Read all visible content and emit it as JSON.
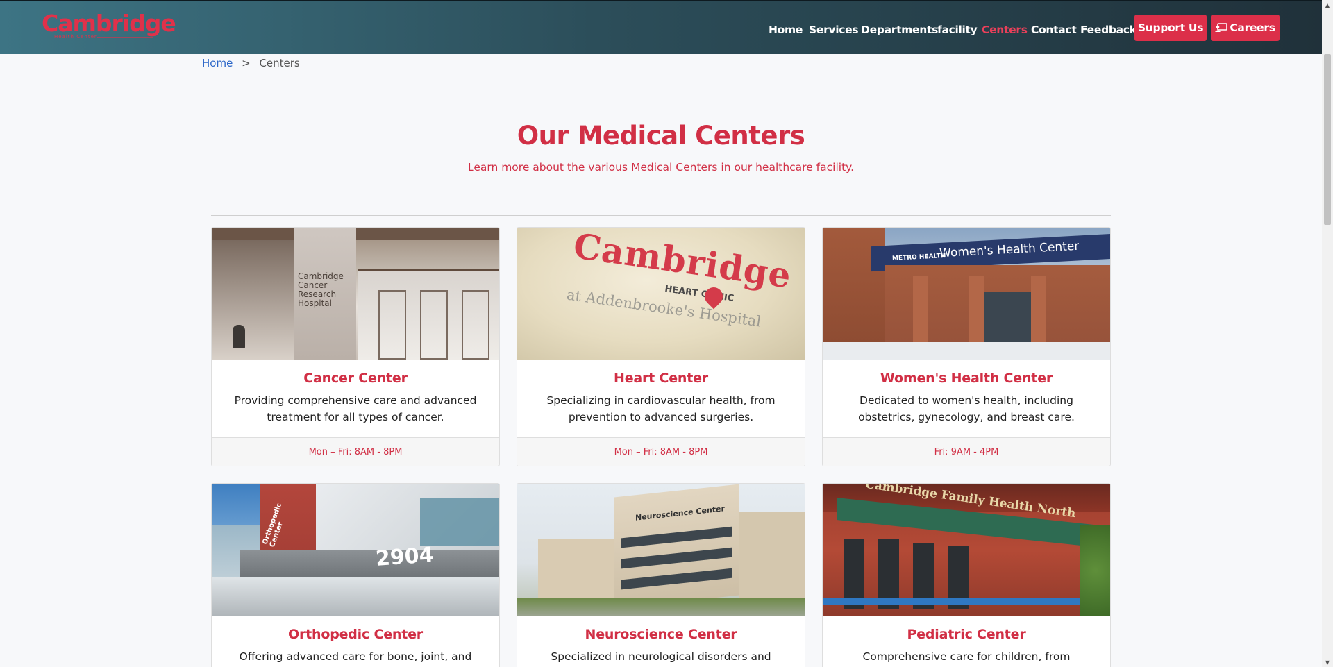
{
  "brand": {
    "name": "Cambridge",
    "tagline": "Health Center"
  },
  "nav": {
    "items": [
      "Home",
      "Services",
      "Departments",
      "facility",
      "Centers",
      "Contact",
      "Feedback"
    ],
    "active": "Centers",
    "support_label": "Support Us",
    "careers_label": "Careers"
  },
  "breadcrumb": {
    "home": "Home",
    "separator": ">",
    "current": "Centers"
  },
  "page": {
    "title": "Our Medical Centers",
    "subtitle": "Learn more about the various Medical Centers in our healthcare facility."
  },
  "centers": [
    {
      "title": "Cancer Center",
      "description": "Providing comprehensive care and advanced treatment for all types of cancer.",
      "hours": "Mon – Fri: 8AM - 8PM",
      "sign": "Cambridge Cancer Research Hospital"
    },
    {
      "title": "Heart Center",
      "description": "Specializing in cardiovascular health, from prevention to advanced surgeries.",
      "hours": "Mon – Fri: 8AM - 8PM",
      "sign": "Cambridge",
      "sign_sub": "HEART CLINIC",
      "sign_sub2": "at Addenbrooke's Hospital"
    },
    {
      "title": "Women's Health Center",
      "description": "Dedicated to women's health, including obstetrics, gynecology, and breast care.",
      "hours": "Fri: 9AM - 4PM",
      "sign": "Women's Health Center",
      "sign_sub": "METRO HEALTH"
    },
    {
      "title": "Orthopedic Center",
      "description": "Offering advanced care for bone, joint, and muscle",
      "hours": "",
      "sign": "2904",
      "sign_sub": "Orthopedic Center"
    },
    {
      "title": "Neuroscience Center",
      "description": "Specialized in neurological disorders and advanced",
      "hours": "",
      "sign": "Neuroscience Center"
    },
    {
      "title": "Pediatric Center",
      "description": "Comprehensive care for children, from newborns to",
      "hours": "",
      "sign": "Cambridge Family Health North"
    }
  ],
  "colors": {
    "accent": "#d12f45",
    "header_start": "#3d7484",
    "header_end": "#20313a",
    "link": "#2b66c8"
  }
}
